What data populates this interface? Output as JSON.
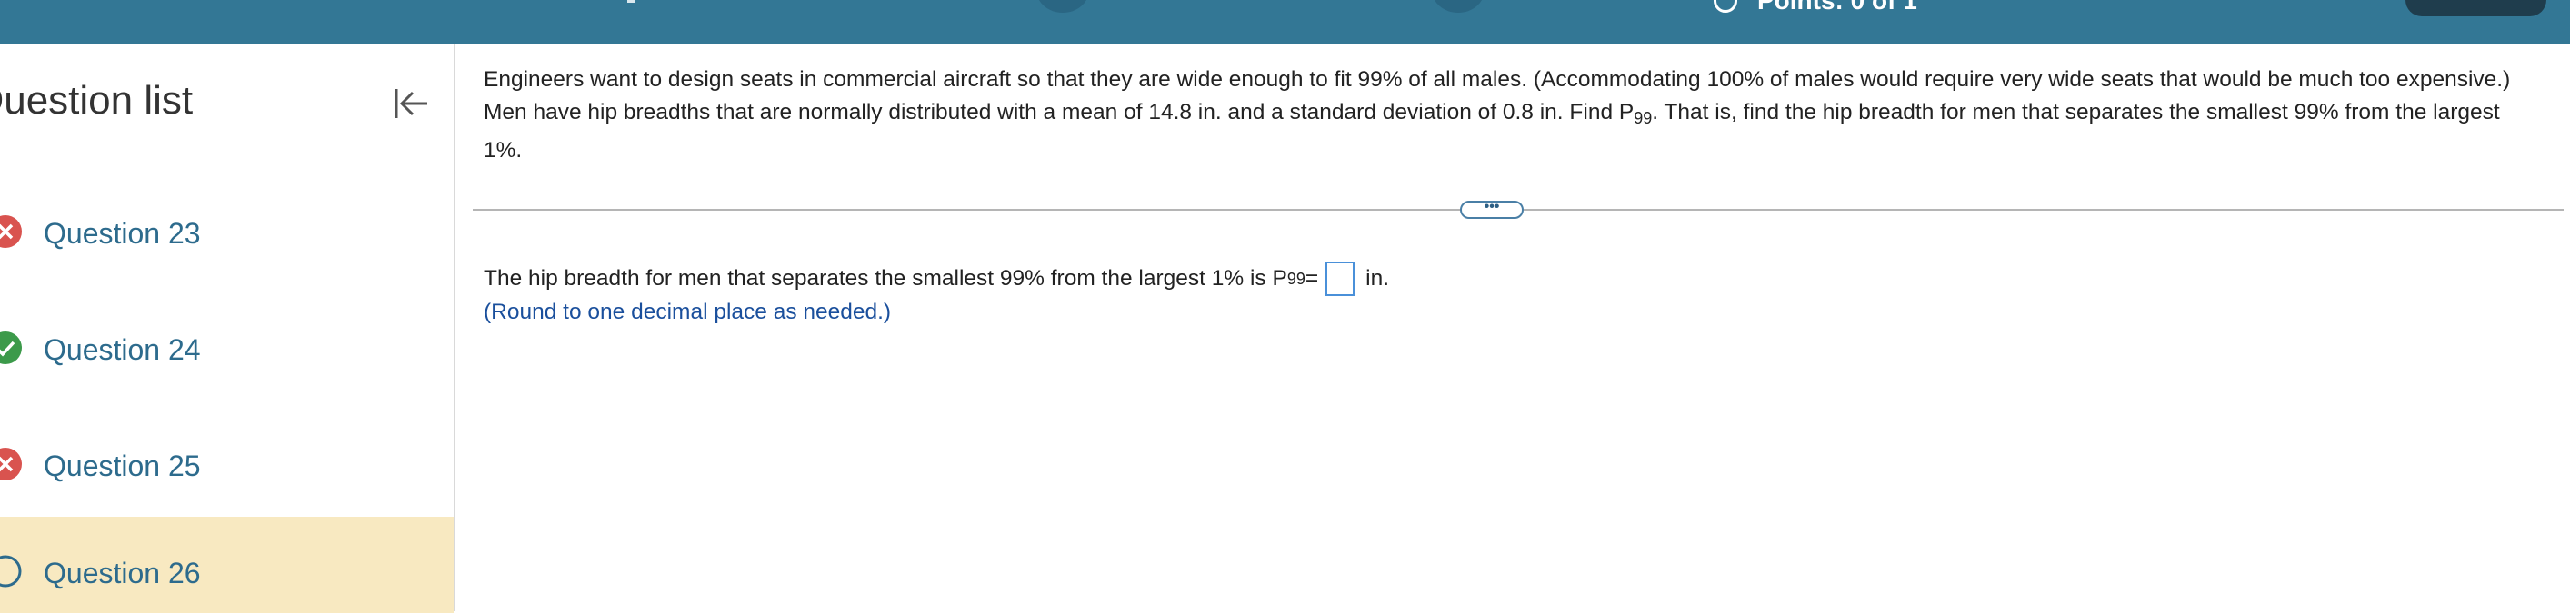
{
  "top_bar": {
    "points_label": "Points: 0 of 1",
    "colors": {
      "bar": "#337795",
      "dark_button": "#1f3d4d"
    }
  },
  "sidebar": {
    "title": "Question list",
    "collapse_icon": "collapse-left-icon",
    "questions": [
      {
        "label": "Question 23",
        "status": "incorrect",
        "icon": "incorrect-x-icon",
        "color": "#d9534f"
      },
      {
        "label": "Question 24",
        "status": "correct",
        "icon": "correct-check-icon",
        "color": "#3c9a4a"
      },
      {
        "label": "Question 25",
        "status": "incorrect",
        "icon": "incorrect-x-icon",
        "color": "#d9534f"
      },
      {
        "label": "Question 26",
        "status": "current",
        "icon": "unanswered-circle-icon",
        "color": "#2d6b8d"
      }
    ]
  },
  "question": {
    "part1": "Engineers want to design seats in commercial aircraft so that they are wide enough to fit 99% of all males. (Accommodating 100% of males would require very wide seats that would be much too expensive.) Men have hip breadths that are normally distributed with a mean of 14.8  in. and a standard deviation of 0.8 in. Find P",
    "sub": "99",
    "part2": ". That is, find the hip breadth for men that separates the smallest 99% from the largest 1%."
  },
  "more_button": "•••",
  "answer": {
    "prefix": "The hip breadth for men that separates the smallest 99% from the largest 1% is P",
    "sub": "99",
    "equals": " =",
    "value": "",
    "unit": "in.",
    "note": "(Round to one decimal place as needed.)"
  }
}
